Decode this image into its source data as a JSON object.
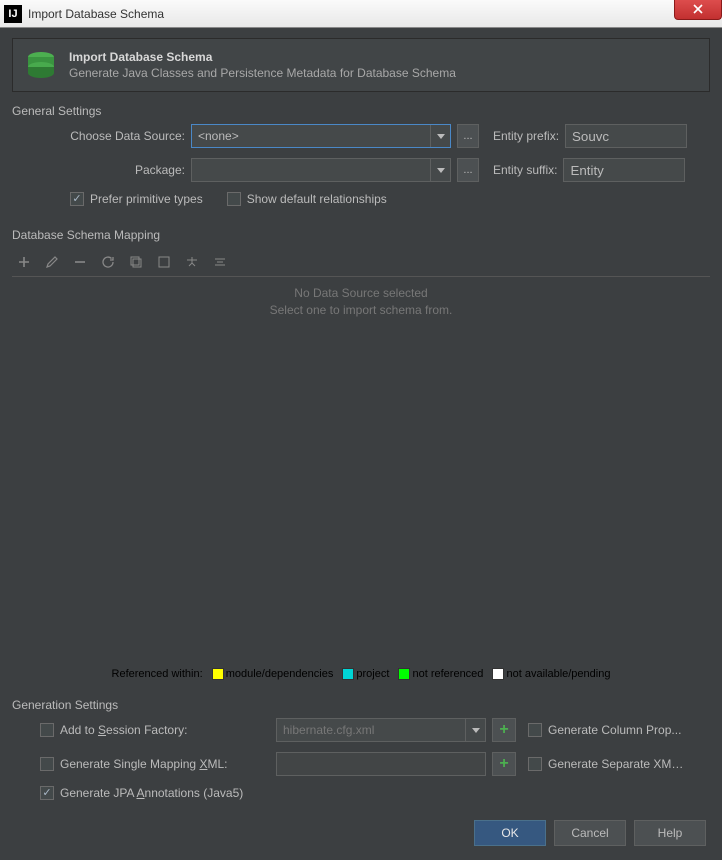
{
  "titlebar": {
    "title": "Import Database Schema"
  },
  "header": {
    "title": "Import Database Schema",
    "subtitle": "Generate Java Classes and Persistence Metadata for Database Schema"
  },
  "general": {
    "section_label": "General Settings",
    "choose_data_source_label": "Choose Data Source:",
    "choose_data_source_value": "<none>",
    "package_label": "Package:",
    "package_value": "",
    "entity_prefix_label": "Entity prefix:",
    "entity_prefix_value": "Souvc",
    "entity_suffix_label": "Entity suffix:",
    "entity_suffix_value": "Entity",
    "prefer_primitive_label": "Prefer primitive types",
    "show_default_rel_label": "Show default relationships"
  },
  "mapping": {
    "section_label": "Database Schema Mapping",
    "empty_line1": "No Data Source selected",
    "empty_line2": "Select one to import schema from."
  },
  "legend": {
    "prefix": "Referenced within:",
    "module": "module/dependencies",
    "project": "project",
    "notref": "not referenced",
    "na": "not available/pending",
    "colors": {
      "module": "#ffff00",
      "project": "#00d5d5",
      "notref": "#00ff00",
      "na": "#ffffff"
    }
  },
  "generation": {
    "section_label": "Generation Settings",
    "add_session_label": "Add to Session Factory:",
    "add_session_value": "hibernate.cfg.xml",
    "gen_col_prop_label": "Generate Column Properties",
    "gen_single_xml_label": "Generate Single Mapping XML:",
    "gen_single_xml_value": "",
    "gen_separate_xml_label": "Generate Separate XML per Entity",
    "gen_jpa_label": "Generate JPA Annotations (Java5)"
  },
  "footer": {
    "ok": "OK",
    "cancel": "Cancel",
    "help": "Help"
  }
}
